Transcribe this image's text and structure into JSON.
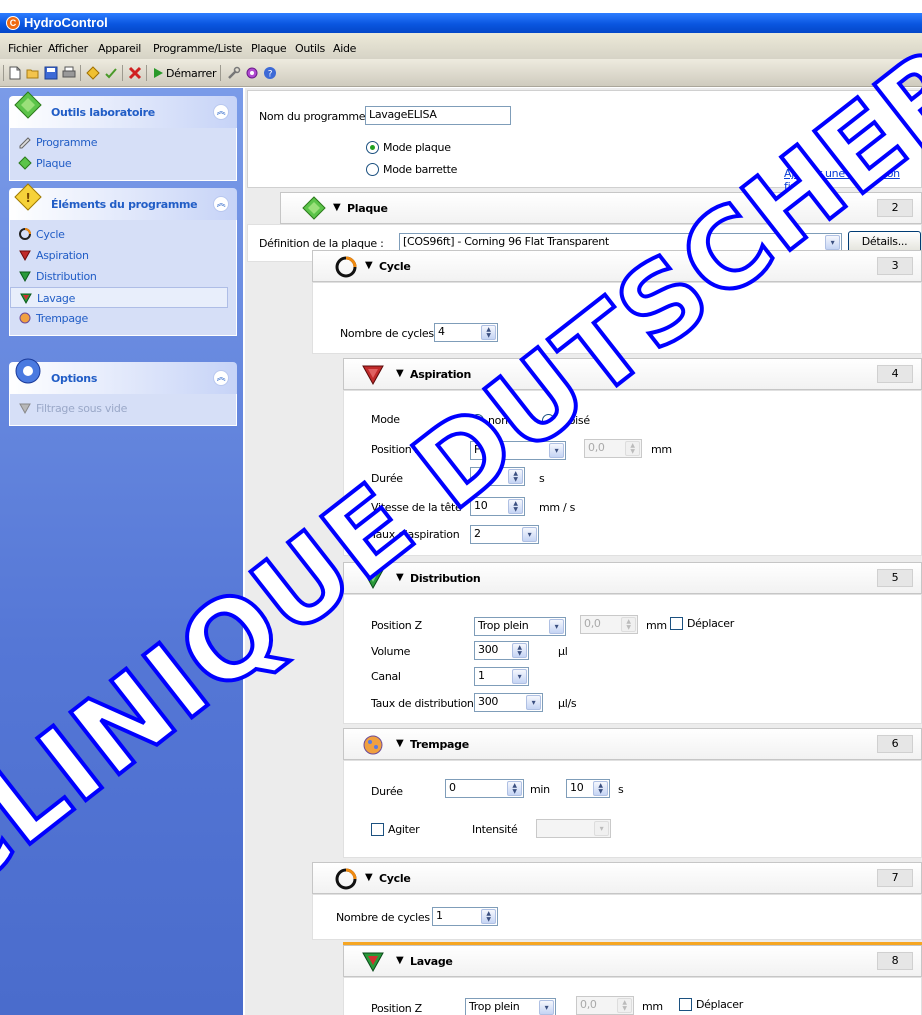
{
  "window": {
    "title": "HydroControl"
  },
  "menu": [
    "Fichier",
    "Afficher",
    "Appareil",
    "Programme/Liste",
    "Plaque",
    "Outils",
    "Aide"
  ],
  "toolbar": {
    "start_label": "Démarrer"
  },
  "sidebar": {
    "lab_tools": {
      "title": "Outils laboratoire",
      "items": [
        "Programme",
        "Plaque"
      ]
    },
    "program_elements": {
      "title": "Éléments du programme",
      "items": [
        "Cycle",
        "Aspiration",
        "Distribution",
        "Lavage",
        "Trempage"
      ],
      "selected": "Lavage"
    },
    "options": {
      "title": "Options",
      "items": [
        "Filtrage sous vide"
      ]
    }
  },
  "program": {
    "name_label": "Nom du programme",
    "name_value": "LavageELISA",
    "mode_plate": "Mode plaque",
    "mode_strip": "Mode barrette",
    "mode_selected": "Mode plaque",
    "final_aspiration_link": "Ajouter une aspiration finale"
  },
  "plate": {
    "title": "Plaque",
    "number": "2",
    "definition_label": "Définition de la plaque :",
    "definition_value": "[COS96ft] - Corning 96 Flat Transparent",
    "details_button": "Détails..."
  },
  "cycle1": {
    "title": "Cycle",
    "number": "3",
    "count_label": "Nombre de cycles :",
    "count_value": "4"
  },
  "aspiration": {
    "title": "Aspiration",
    "number": "4",
    "mode_label": "Mode",
    "mode_normal": "normal",
    "mode_crossed": "croisé",
    "mode_selected": "normal",
    "posz_label": "Position Z",
    "posz_value": "Fond",
    "posz_offset": "0,0",
    "posz_unit": "mm",
    "duration_label": "Durée",
    "duration_value": "4",
    "duration_unit": "s",
    "head_speed_label": "Vitesse de la tête",
    "head_speed_value": "10",
    "head_speed_unit": "mm / s",
    "rate_label": "Taux d'aspiration",
    "rate_value": "2"
  },
  "distribution": {
    "title": "Distribution",
    "number": "5",
    "posz_label": "Position Z",
    "posz_value": "Trop plein",
    "posz_offset": "0,0",
    "posz_unit": "mm",
    "move_label": "Déplacer",
    "volume_label": "Volume",
    "volume_value": "300",
    "volume_unit": "µl",
    "channel_label": "Canal",
    "channel_value": "1",
    "rate_label": "Taux de distribution",
    "rate_value": "300",
    "rate_unit": "µl/s"
  },
  "soak": {
    "title": "Trempage",
    "number": "6",
    "duration_label": "Durée",
    "min_value": "0",
    "min_unit": "min",
    "sec_value": "10",
    "sec_unit": "s",
    "shake_label": "Agiter",
    "intensity_label": "Intensité",
    "intensity_value": ""
  },
  "cycle2": {
    "title": "Cycle",
    "number": "7",
    "count_label": "Nombre de cycles :",
    "count_value": "1"
  },
  "wash": {
    "title": "Lavage",
    "number": "8",
    "posz_label": "Position Z",
    "posz_value": "Trop plein",
    "posz_offset": "0,0",
    "posz_unit": "mm",
    "move_label": "Déplacer"
  },
  "watermark": "CLINIQUE DUTSCHER",
  "colors": {
    "title_bar": "#0a56e0",
    "sidebar": "#5577d6",
    "link": "#0a3fd6",
    "selection_bar": "#f6a623",
    "watermark": "#0000ff"
  }
}
